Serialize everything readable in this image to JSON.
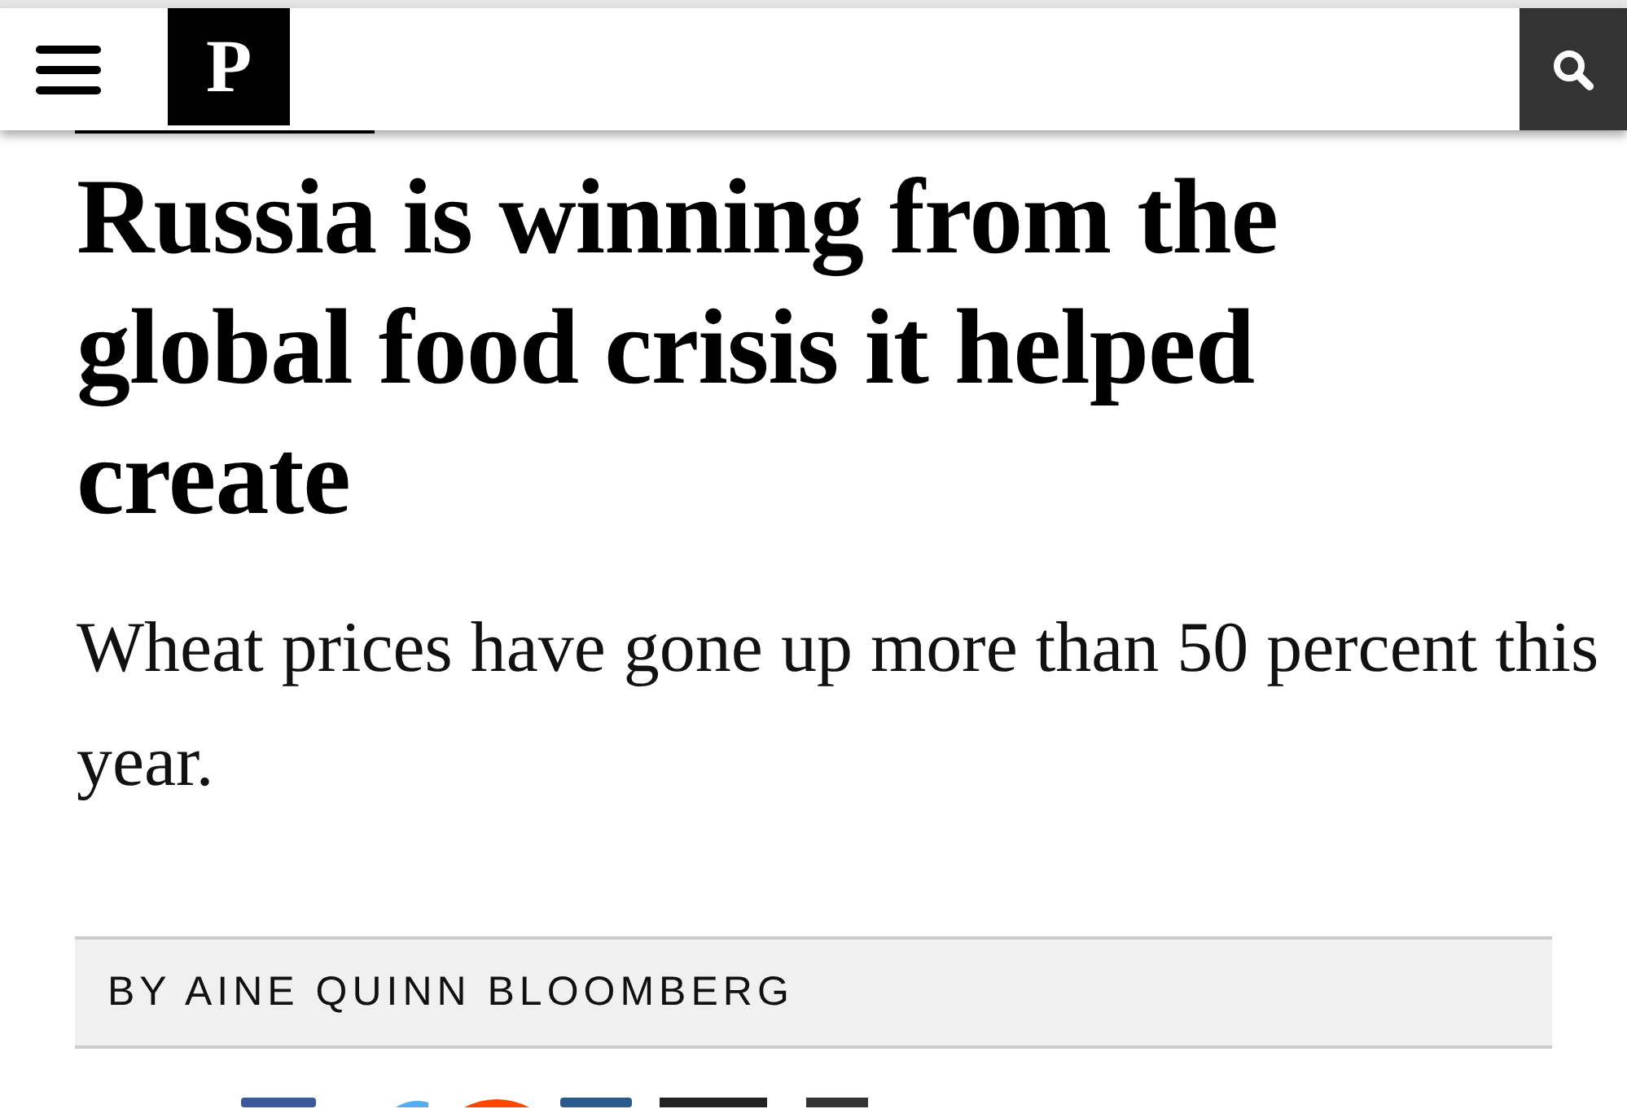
{
  "header": {
    "logo": "P"
  },
  "article": {
    "headline": "Russia is winning from the global food crisis it helped create",
    "subheadline": "Wheat prices have gone up more than 50 percent this year.",
    "byline": "BY AINE QUINN BLOOMBERG"
  }
}
